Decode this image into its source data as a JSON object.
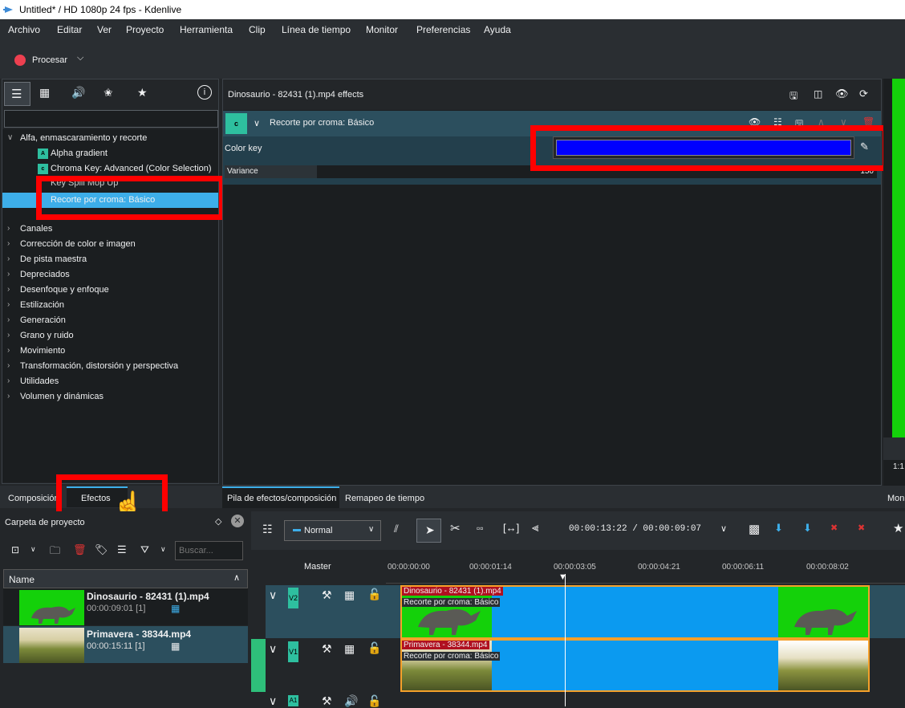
{
  "window": {
    "title": "Untitled* / HD 1080p 24 fps - Kdenlive"
  },
  "menu": [
    "Archivo",
    "Editar",
    "Ver",
    "Proyecto",
    "Herramienta",
    "Clip",
    "Línea de tiempo",
    "Monitor",
    "Preferencias",
    "Ayuda"
  ],
  "toolbar": {
    "render_label": "Procesar"
  },
  "effects_list": {
    "category_open": "Alfa, enmascaramiento y recorte",
    "items": [
      "Alpha gradient",
      "Chroma Key: Advanced (Color Selection)",
      "Key Spill Mop Up",
      "Recorte por croma: Básico"
    ],
    "item_icons": [
      "A",
      "c"
    ],
    "categories": [
      "Canales",
      "Corrección de color e imagen",
      "De pista maestra",
      "Depreciados",
      "Desenfoque y enfoque",
      "Estilización",
      "Generación",
      "Grano y ruido",
      "Movimiento",
      "Transformación, distorsión y perspectiva",
      "Utilidades",
      "Volumen y dinámicas"
    ]
  },
  "effect_stack": {
    "title": "Dinosaurio - 82431 (1).mp4 effects",
    "effect_name": "Recorte por croma: Básico",
    "effect_icon": "c",
    "color_key_label": "Color key",
    "color_key_value": "#0000ff",
    "variance_label": "Variance",
    "variance_value": "150",
    "variance_fraction": 0.59
  },
  "left_tabs": [
    "Composición",
    "Efectos"
  ],
  "stack_tabs": [
    "Pila de efectos/composición",
    "Remapeo de tiempo"
  ],
  "monitor": {
    "tab": "Mon",
    "zoom": "1:1"
  },
  "project_bin": {
    "title": "Carpeta de proyecto",
    "search_placeholder": "Buscar...",
    "column": "Name",
    "clips": [
      {
        "name": "Dinosaurio - 82431 (1).mp4",
        "duration": "00:00:09:01 [1]"
      },
      {
        "name": "Primavera - 38344.mp4",
        "duration": "00:00:15:11 [1]"
      }
    ]
  },
  "timeline": {
    "mode": "Normal",
    "timecode": "00:00:13:22 / 00:00:09:07",
    "master_label": "Master",
    "ruler": [
      "00:00:00:00",
      "00:00:01:14",
      "00:00:03:05",
      "00:00:04:21",
      "00:00:06:11",
      "00:00:08:02"
    ],
    "tracks": [
      {
        "label": "V2",
        "clip_name": "Dinosaurio - 82431 (1).mp4",
        "clip_effect": "Recorte por croma: Básico"
      },
      {
        "label": "V1",
        "clip_name": "Primavera - 38344.mp4",
        "clip_effect": "Recorte por croma: Básico"
      },
      {
        "label": "A1"
      }
    ]
  }
}
